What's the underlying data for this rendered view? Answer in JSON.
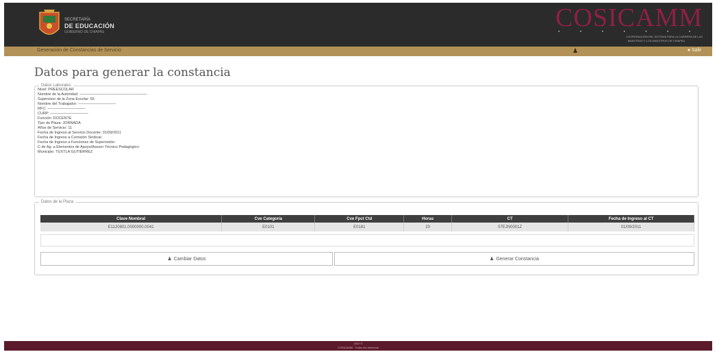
{
  "header": {
    "school_line": "SECRETARÍA",
    "title": "DE EDUCACIÓN",
    "subtitle": "GOBIERNO DE CHIAPAS",
    "brand": "COSICAMM",
    "brand_dots": "• • • • • • •",
    "brand_sub_1": "COORDINACIÓN DEL SISTEMA PARA LA CARRERA DE LAS",
    "brand_sub_2": "MAESTRAS Y LOS MAESTROS DE CHIAPAS"
  },
  "nav": {
    "system_name": "Generación de Constancias de Servicio",
    "user_icon": "user-icon",
    "exit_label": "● Salir"
  },
  "page_title": "Datos para generar la constancia",
  "datos_laborales": {
    "legend": "Datos Laborales",
    "fields": [
      "Nivel: PREESCOLAR",
      "Nombre de la Autoridad: ——————————————————",
      "Supervisor de la Zona Escolar: 55",
      "Nombre del Trabajador: ——————————",
      "RFC: ——————————",
      "CURP: ——————————",
      "Función: DOCENTE",
      "Tipo de Plaza: JORNADA",
      "Años de Servicio: 11",
      "Fecha de Ingreso al Servicio Docente: 01/09/2011",
      "Fecha de Ingreso a Comisión Sindical:",
      "Fecha de Ingreso a Funciones de Supervisión:",
      "C de Ag. a Elementos de Apoyo/Asesor Técnico Pedagógico:",
      "Municipio: TUXTLA GUTIÉRREZ"
    ]
  },
  "datos_plaza": {
    "legend": "Datos de la Plaza",
    "headers": [
      "Clave Nombral",
      "Cve Categoría",
      "Cve Fpct Ctd",
      "Horas",
      "CT",
      "Fecha de Ingreso al CT"
    ],
    "row": [
      "E1120801.0000000.0041",
      "E0101",
      "E0181",
      "20",
      "07EJN0001Z",
      "01/09/2011"
    ]
  },
  "buttons": {
    "cambiar_label": "Cambiar Datos",
    "generar_label": "Generar Constancia"
  },
  "footer": {
    "line1": "2022 ©",
    "line2": "COSICAMM · Todos los derechos"
  }
}
